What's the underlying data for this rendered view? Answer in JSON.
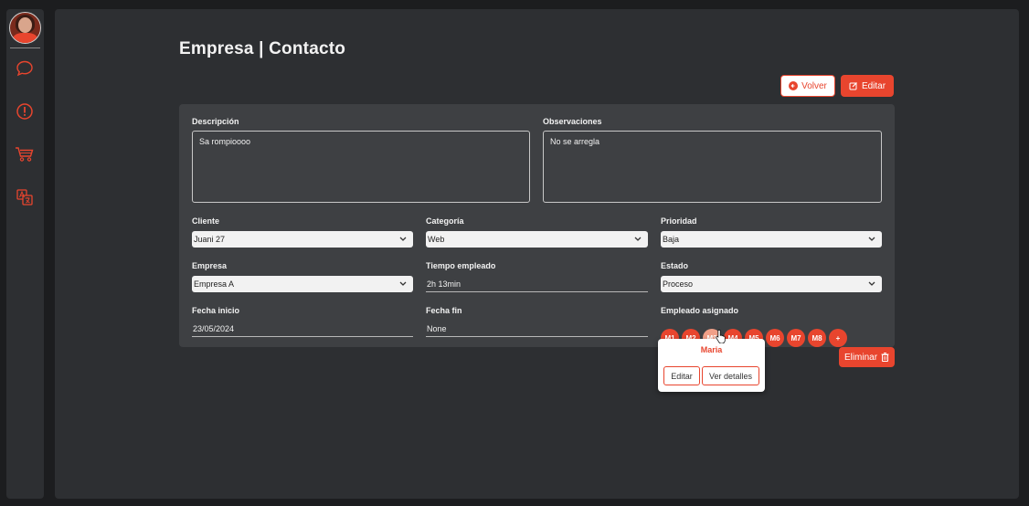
{
  "sidebar": {
    "items": [
      {
        "icon": "chat-bubble-icon"
      },
      {
        "icon": "alert-icon"
      },
      {
        "icon": "cart-icon"
      },
      {
        "icon": "translate-icon"
      }
    ],
    "accent": "#e8452e"
  },
  "page": {
    "title": "Empresa | Contacto"
  },
  "actions": {
    "volver_label": "Volver",
    "editar_label": "Editar",
    "eliminar_label": "Eliminar"
  },
  "form": {
    "descripcion": {
      "label": "Descripción",
      "value": "Sa rompioooo"
    },
    "observaciones": {
      "label": "Observaciones",
      "value": "No se arregla"
    },
    "cliente": {
      "label": "Cliente",
      "value": "Juani 27"
    },
    "categoria": {
      "label": "Categoría",
      "value": "Web"
    },
    "prioridad": {
      "label": "Prioridad",
      "value": "Baja"
    },
    "empresa": {
      "label": "Empresa",
      "value": "Empresa A"
    },
    "tiempo": {
      "label": "Tiempo empleado",
      "value": "2h 13min"
    },
    "estado": {
      "label": "Estado",
      "value": "Proceso"
    },
    "fecha_inicio": {
      "label": "Fecha inicio",
      "value": "23/05/2024"
    },
    "fecha_fin": {
      "label": "Fecha fin",
      "value": "None"
    },
    "empleado": {
      "label": "Empleado asignado"
    }
  },
  "employees": [
    "M1",
    "M2",
    "M3",
    "M4",
    "M5",
    "M6",
    "M7",
    "M8",
    "+"
  ],
  "popover": {
    "name": "Maria",
    "edit_label": "Editar",
    "details_label": "Ver detalles"
  },
  "colors": {
    "accent": "#e8452e",
    "background": "#1c1d1f",
    "panel": "#2d2f32",
    "card": "#3e4043"
  }
}
